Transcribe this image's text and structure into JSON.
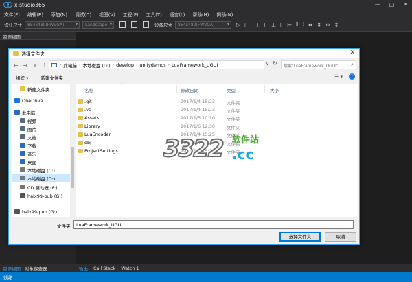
{
  "app": {
    "title": "x-studio365",
    "window_controls": [
      "—",
      "□",
      "✕"
    ]
  },
  "menu": [
    "文件(F)",
    "编辑(E)",
    "添加(N)",
    "调试(D)",
    "视图(V)",
    "工程(P)",
    "工具(T)",
    "语言(L)",
    "帮助(H)",
    "揭助(N)"
  ],
  "toolbar": {
    "design_size_label": "设计尺寸",
    "design_size_value": "854x480(FWVGA)",
    "orientation_value": "Landscape",
    "device_size_label": "设备尺寸",
    "device_size_value": "854x480(FWVGA)"
  },
  "left_panel": {
    "title": "资源视图",
    "tabs": [
      {
        "label": "资源视图",
        "active": true
      },
      {
        "label": "对象探查器",
        "active": false
      }
    ]
  },
  "bottom_tabs": [
    {
      "label": "输出",
      "active": true
    },
    {
      "label": "Call Stack",
      "active": false
    },
    {
      "label": "Watch 1",
      "active": false
    }
  ],
  "status": {
    "text": "就绪"
  },
  "dialog": {
    "title": "选择文件夹",
    "close_glyph": "✕",
    "nav": {
      "back": "←",
      "forward": "→",
      "dropdown": "∨",
      "up": "↑"
    },
    "breadcrumb": [
      "此电脑",
      "本地磁盘 (D:)",
      "develop",
      "unitydemos",
      "LuaFramework_UGUI"
    ],
    "breadcrumb_sep": "›",
    "search_placeholder": "搜索\"LuaFramework_UGUI\"",
    "toolbar": {
      "organize": "组织 ▾",
      "new_folder": "新建文件夹",
      "view_glyph": "☰ ▾",
      "help_glyph": "?"
    },
    "nav_pane": [
      {
        "label": "新建文件夹",
        "icon_color": "#e8c04e",
        "selected": false
      },
      {
        "label": "OneDrive",
        "icon_color": "#1a73e8",
        "selected": false
      },
      {
        "label": "此电脑",
        "icon_color": "#2a6cc2",
        "selected": false
      },
      {
        "label": "视频",
        "icon_color": "#5a6b80",
        "selected": false
      },
      {
        "label": "图片",
        "icon_color": "#5a6b80",
        "selected": false
      },
      {
        "label": "文档",
        "icon_color": "#5a6b80",
        "selected": false
      },
      {
        "label": "下载",
        "icon_color": "#2a6cc2",
        "selected": false
      },
      {
        "label": "音乐",
        "icon_color": "#2a6cc2",
        "selected": false
      },
      {
        "label": "桌面",
        "icon_color": "#2a6cc2",
        "selected": false
      },
      {
        "label": "本地磁盘 (C:)",
        "icon_color": "#777777",
        "selected": false
      },
      {
        "label": "本地磁盘 (D:)",
        "icon_color": "#777777",
        "selected": true
      },
      {
        "label": "CD 驱动器 (F:)",
        "icon_color": "#777777",
        "selected": false
      },
      {
        "label": "halx99-pub (G:)",
        "icon_color": "#555555",
        "selected": false
      },
      {
        "label": "halx99-pub (G:)",
        "icon_color": "#555555",
        "selected": false
      }
    ],
    "columns": [
      "名称",
      "修改日期",
      "类型",
      "大小"
    ],
    "sort_glyph": "^",
    "files": [
      {
        "name": ".git",
        "date": "2017/1/4 15:23",
        "type": "文件夹"
      },
      {
        "name": ".vs",
        "date": "2017/1/4 15:23",
        "type": "文件夹"
      },
      {
        "name": "Assets",
        "date": "2017/1/5 10:10",
        "type": "文件夹"
      },
      {
        "name": "Library",
        "date": "2017/1/6 12:30",
        "type": "文件夹"
      },
      {
        "name": "LuaEncoder",
        "date": "2017/1/4 15:25",
        "type": "文件夹"
      },
      {
        "name": "obj",
        "date": "2017/1/4 15:25",
        "type": "文件夹"
      },
      {
        "name": "ProjectSettings",
        "date": "2017/1/4 15:25",
        "type": "文件夹"
      }
    ],
    "folder_label": "文件夹:",
    "folder_value": "LuaFramework_UGUI",
    "buttons": {
      "select": "选择文件夹",
      "cancel": "取消"
    }
  },
  "watermark": {
    "digits": "3322",
    "cc": ".cc",
    "site": "软件站"
  }
}
